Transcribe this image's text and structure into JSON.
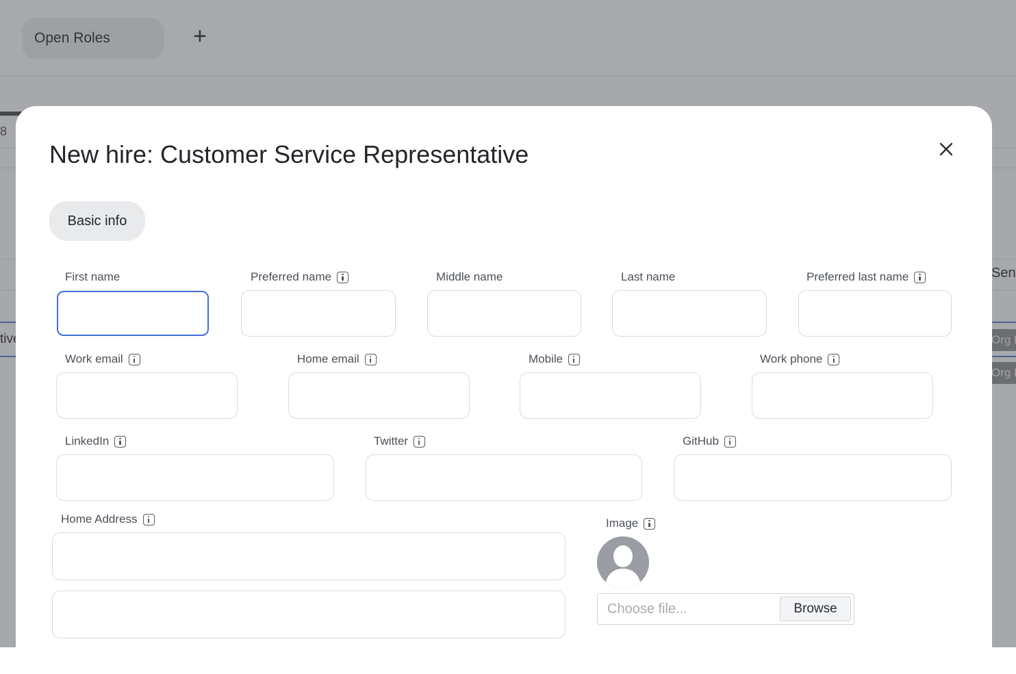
{
  "background": {
    "tab_label": "Open Roles",
    "add_tab_symbol": "+",
    "left_number": "8",
    "left_text": "tive",
    "right_text": "Sen",
    "org_labels": [
      "Org F",
      "Org F"
    ]
  },
  "modal": {
    "title": "New hire: Customer Service Representative",
    "close_icon": "close-icon",
    "tabs": [
      {
        "label": "Basic info",
        "active": true
      }
    ],
    "fields": {
      "first_name": {
        "label": "First name",
        "value": "",
        "focused": true
      },
      "preferred_name": {
        "label": "Preferred name",
        "value": ""
      },
      "middle_name": {
        "label": "Middle name",
        "value": ""
      },
      "last_name": {
        "label": "Last name",
        "value": ""
      },
      "preferred_last_name": {
        "label": "Preferred last name",
        "value": ""
      },
      "work_email": {
        "label": "Work email",
        "value": ""
      },
      "home_email": {
        "label": "Home email",
        "value": ""
      },
      "mobile": {
        "label": "Mobile",
        "value": ""
      },
      "work_phone": {
        "label": "Work phone",
        "value": ""
      },
      "linkedin": {
        "label": "LinkedIn",
        "value": ""
      },
      "twitter": {
        "label": "Twitter",
        "value": ""
      },
      "github": {
        "label": "GitHub",
        "value": ""
      },
      "home_address": {
        "label": "Home Address",
        "line1": "",
        "line2": ""
      },
      "image": {
        "label": "Image",
        "file_placeholder": "Choose file...",
        "browse_label": "Browse"
      }
    }
  },
  "colors": {
    "focus_border": "#3e6fd8",
    "input_border": "#d9dbde",
    "overlay": "rgba(60,62,66,0.42)"
  }
}
